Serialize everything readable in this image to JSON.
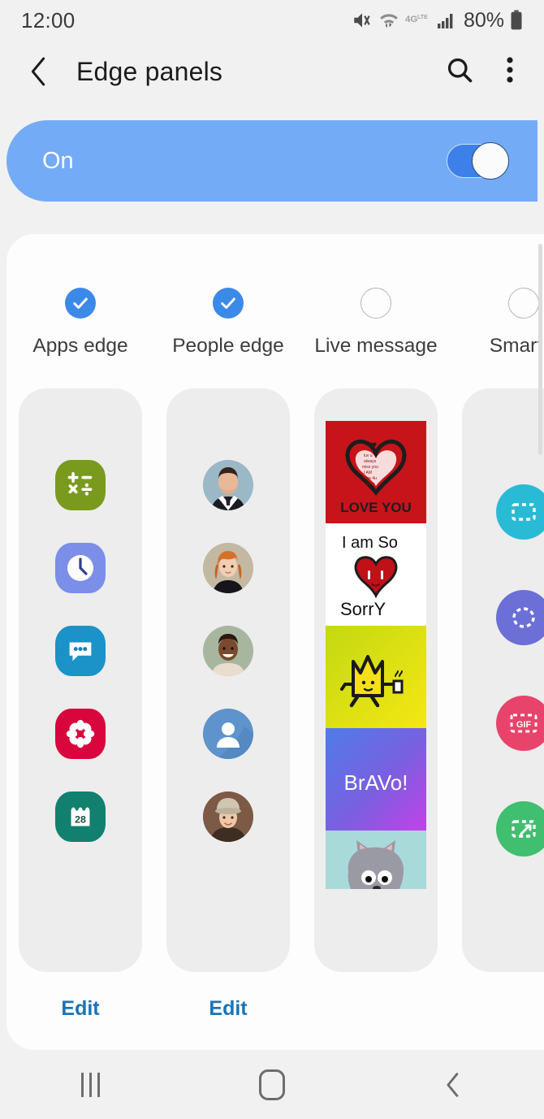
{
  "status_bar": {
    "time": "12:00",
    "battery_percent": "80%",
    "network_label": "4G",
    "network_sup": "LTE",
    "icons": [
      "mute-icon",
      "wifi-icon",
      "network-4glte-icon",
      "signal-bars-icon",
      "battery-icon"
    ]
  },
  "app_bar": {
    "back_icon": "chevron-left-icon",
    "title": "Edge panels",
    "search_icon": "search-icon",
    "overflow_icon": "more-vertical-icon"
  },
  "master_toggle": {
    "label": "On",
    "enabled": true,
    "track_color": "#74abf6",
    "switch_on_color": "#3d80ea"
  },
  "panels": [
    {
      "id": "apps-edge",
      "label": "Apps edge",
      "checked": true,
      "edit_label": "Edit",
      "items": [
        {
          "name": "calculator-icon",
          "bg": "#7a9a1e"
        },
        {
          "name": "clock-icon",
          "bg": "#7b8fe8"
        },
        {
          "name": "messages-icon",
          "bg": "#1b92c8"
        },
        {
          "name": "gallery-icon",
          "bg": "#d8063c"
        },
        {
          "name": "calendar-icon",
          "bg": "#11806f",
          "day": "28"
        }
      ]
    },
    {
      "id": "people-edge",
      "label": "People edge",
      "checked": true,
      "edit_label": "Edit",
      "items": [
        {
          "name": "contact-avatar-man-suit",
          "bg": "#9bb8c6"
        },
        {
          "name": "contact-avatar-redhead-woman",
          "bg": "#c3b9a2"
        },
        {
          "name": "contact-avatar-smiling-man",
          "bg": "#a8b6a0"
        },
        {
          "name": "contact-avatar-placeholder",
          "bg": "#5e93cc"
        },
        {
          "name": "contact-avatar-woman-hat",
          "bg": "#7c5a46"
        }
      ]
    },
    {
      "id": "live-message",
      "label": "Live message",
      "checked": false,
      "edit_label": "",
      "items": [
        {
          "name": "live-message-love-you",
          "caption": "LOVE YOU",
          "bg": "#c6141a"
        },
        {
          "name": "live-message-i-am-so-sorry",
          "caption": "I am So Sorry",
          "bg": "#ffffff"
        },
        {
          "name": "live-message-crown-creature",
          "caption": "",
          "bg": "#d9e021"
        },
        {
          "name": "live-message-bravo",
          "caption": "BrAVo!",
          "bg": "#5b6fe0"
        },
        {
          "name": "live-message-gray-cat",
          "caption": "",
          "bg": "#a9dada"
        }
      ]
    },
    {
      "id": "smart-select",
      "label": "Smart s",
      "checked": false,
      "edit_label": "",
      "items": [
        {
          "name": "smart-select-rectangle-icon",
          "bg": "#29bbd6"
        },
        {
          "name": "smart-select-oval-icon",
          "bg": "#6b6fd6"
        },
        {
          "name": "smart-select-gif-icon",
          "bg": "#e8436b",
          "caption": "GIF"
        },
        {
          "name": "smart-select-pin-icon",
          "bg": "#3fbf6f"
        }
      ]
    }
  ],
  "nav_bar": {
    "recents_icon": "recents-icon",
    "home_icon": "home-icon",
    "back_icon": "back-icon"
  }
}
